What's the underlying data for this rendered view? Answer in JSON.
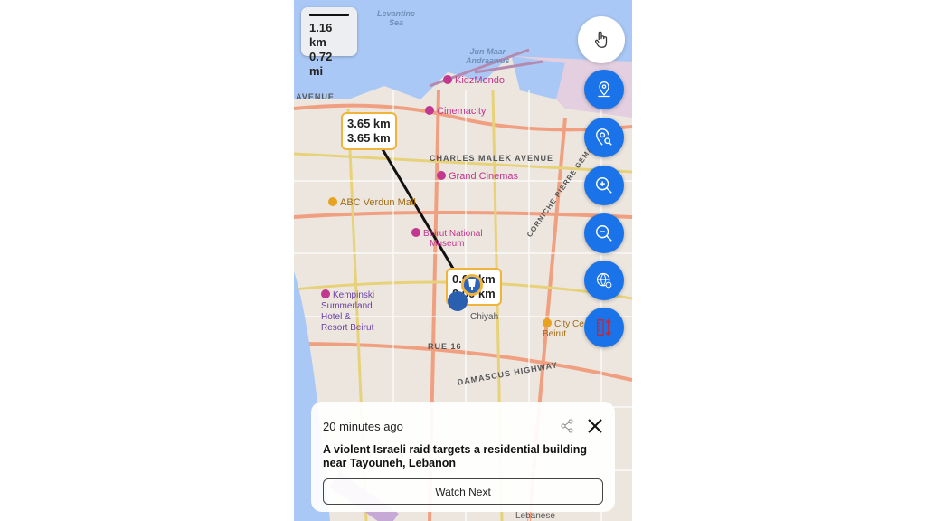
{
  "scale": {
    "km": "1.16 km",
    "mi": "0.72 mi"
  },
  "map_labels": {
    "sea": "Levantine\nSea",
    "port": "Jun Maar\nAndraawus",
    "kidzmondo": "KidzMondo",
    "cinemacity": "Cinemacity",
    "charles_malek": "CHARLES MALEK AVENUE",
    "grand_cinemas": "Grand Cinemas",
    "abc": "ABC Verdun Mall",
    "museum": "Beirut National\nMuseum",
    "kempinski": "Kempinski\nSummerland\nHotel &\nResort Beirut",
    "city_centre": "City Ce\nBeirut",
    "chiyah": "Chiyah",
    "rue16": "RUE 16",
    "damascus": "DAMASCUS HIGHWAY",
    "corniche": "CORNICHE PIERRE GEMAYEL",
    "avenue": "AVENUE",
    "lebanese": "Lebanese"
  },
  "distance_labels": [
    {
      "line1": "3.65 km",
      "line2": "3.65 km"
    },
    {
      "line1": "0.00 km",
      "line2": "0.00 km"
    }
  ],
  "controls": [
    "hand-pointer",
    "location-pin",
    "search-location",
    "zoom-in",
    "zoom-out",
    "globe",
    "measure"
  ],
  "card": {
    "time": "20 minutes ago",
    "title": "A violent Israeli raid targets a residential building near Tayouneh, Lebanon",
    "watch_label": "Watch Next"
  },
  "colors": {
    "accent": "#1a73e8",
    "sea": "#aac8f5",
    "land": "#ece6df",
    "marker_border": "#f0b43a"
  }
}
